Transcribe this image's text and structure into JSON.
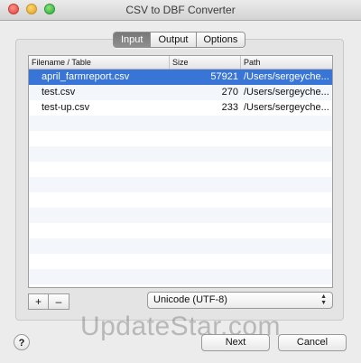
{
  "window": {
    "title": "CSV to DBF Converter"
  },
  "tabs": [
    {
      "label": "Input",
      "active": true
    },
    {
      "label": "Output",
      "active": false
    },
    {
      "label": "Options",
      "active": false
    }
  ],
  "table": {
    "columns": [
      "Filename / Table",
      "Size",
      "Path"
    ],
    "rows": [
      {
        "filename": "april_farmreport.csv",
        "size": "57921",
        "path": "/Users/sergeyche...",
        "selected": true
      },
      {
        "filename": "test.csv",
        "size": "270",
        "path": "/Users/sergeyche...",
        "selected": false
      },
      {
        "filename": "test-up.csv",
        "size": "233",
        "path": "/Users/sergeyche...",
        "selected": false
      }
    ],
    "empty_rows": 12
  },
  "controls": {
    "add_label": "+",
    "remove_label": "–",
    "encoding": "Unicode (UTF-8)",
    "help_label": "?",
    "next_label": "Next",
    "cancel_label": "Cancel"
  },
  "watermark": "UpdateStar.com",
  "colors": {
    "selection": "#3875d7",
    "background": "#ececec"
  },
  "icons": [
    "close-window-icon",
    "minimize-window-icon",
    "zoom-window-icon",
    "popup-arrows-icon",
    "help-icon"
  ]
}
